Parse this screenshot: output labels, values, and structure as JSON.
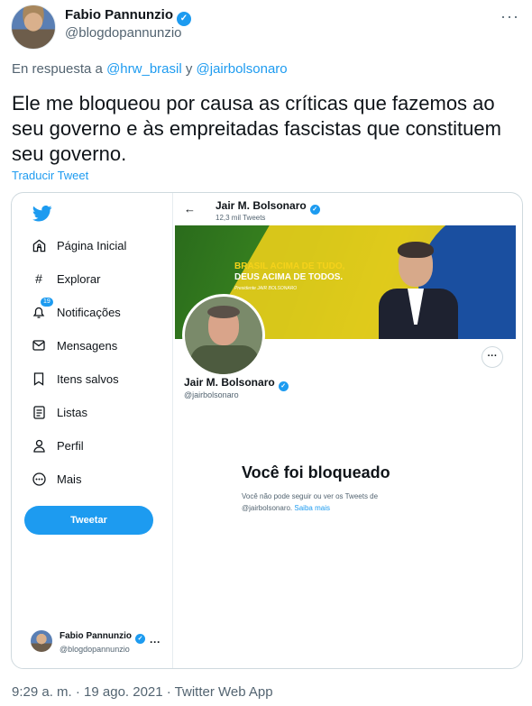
{
  "tweet": {
    "author_name": "Fabio Pannunzio",
    "author_handle": "@blogdopannunzio",
    "more": "···",
    "reply_prefix": "En respuesta a",
    "reply_user1": "@hrw_brasil",
    "reply_and": "y",
    "reply_user2": "@jairbolsonaro",
    "text": "Ele me bloqueou por causa as críticas que fazemos ao seu governo e às empreitadas fascistas que constituem seu governo.",
    "translate": "Traducir Tweet",
    "footer": "9:29 a. m. · 19 ago. 2021 · Twitter Web App"
  },
  "screenshot": {
    "sidebar": {
      "items": [
        {
          "label": "Página Inicial",
          "icon": "home-icon"
        },
        {
          "label": "Explorar",
          "icon": "hashtag-icon"
        },
        {
          "label": "Notificações",
          "icon": "bell-icon"
        },
        {
          "label": "Mensagens",
          "icon": "mail-icon"
        },
        {
          "label": "Itens salvos",
          "icon": "bookmark-icon"
        },
        {
          "label": "Listas",
          "icon": "list-icon"
        },
        {
          "label": "Perfil",
          "icon": "profile-icon"
        },
        {
          "label": "Mais",
          "icon": "more-icon"
        }
      ],
      "notif_badge": "19",
      "tweet_button": "Tweetar",
      "account_name": "Fabio Pannunzio",
      "account_handle": "@blogdopannunzio",
      "account_more": "···"
    },
    "profile": {
      "back": "←",
      "name": "Jair M. Bolsonaro",
      "tweets_count": "12,3 mil Tweets",
      "banner_line1": "BRASIL ACIMA DE TUDO,",
      "banner_line2": "DEUS ACIMA DE TODOS.",
      "banner_sub": "Presidente JAIR BOLSONARO",
      "more": "···",
      "handle": "@jairbolsonaro",
      "blocked_title": "Você foi bloqueado",
      "blocked_text": "Você não pode seguir ou ver os Tweets de @jairbolsonaro.",
      "learn_more": "Saiba mais"
    }
  },
  "colors": {
    "accent": "#1d9bf0",
    "text": "#0f1419",
    "secondary": "#536471"
  }
}
